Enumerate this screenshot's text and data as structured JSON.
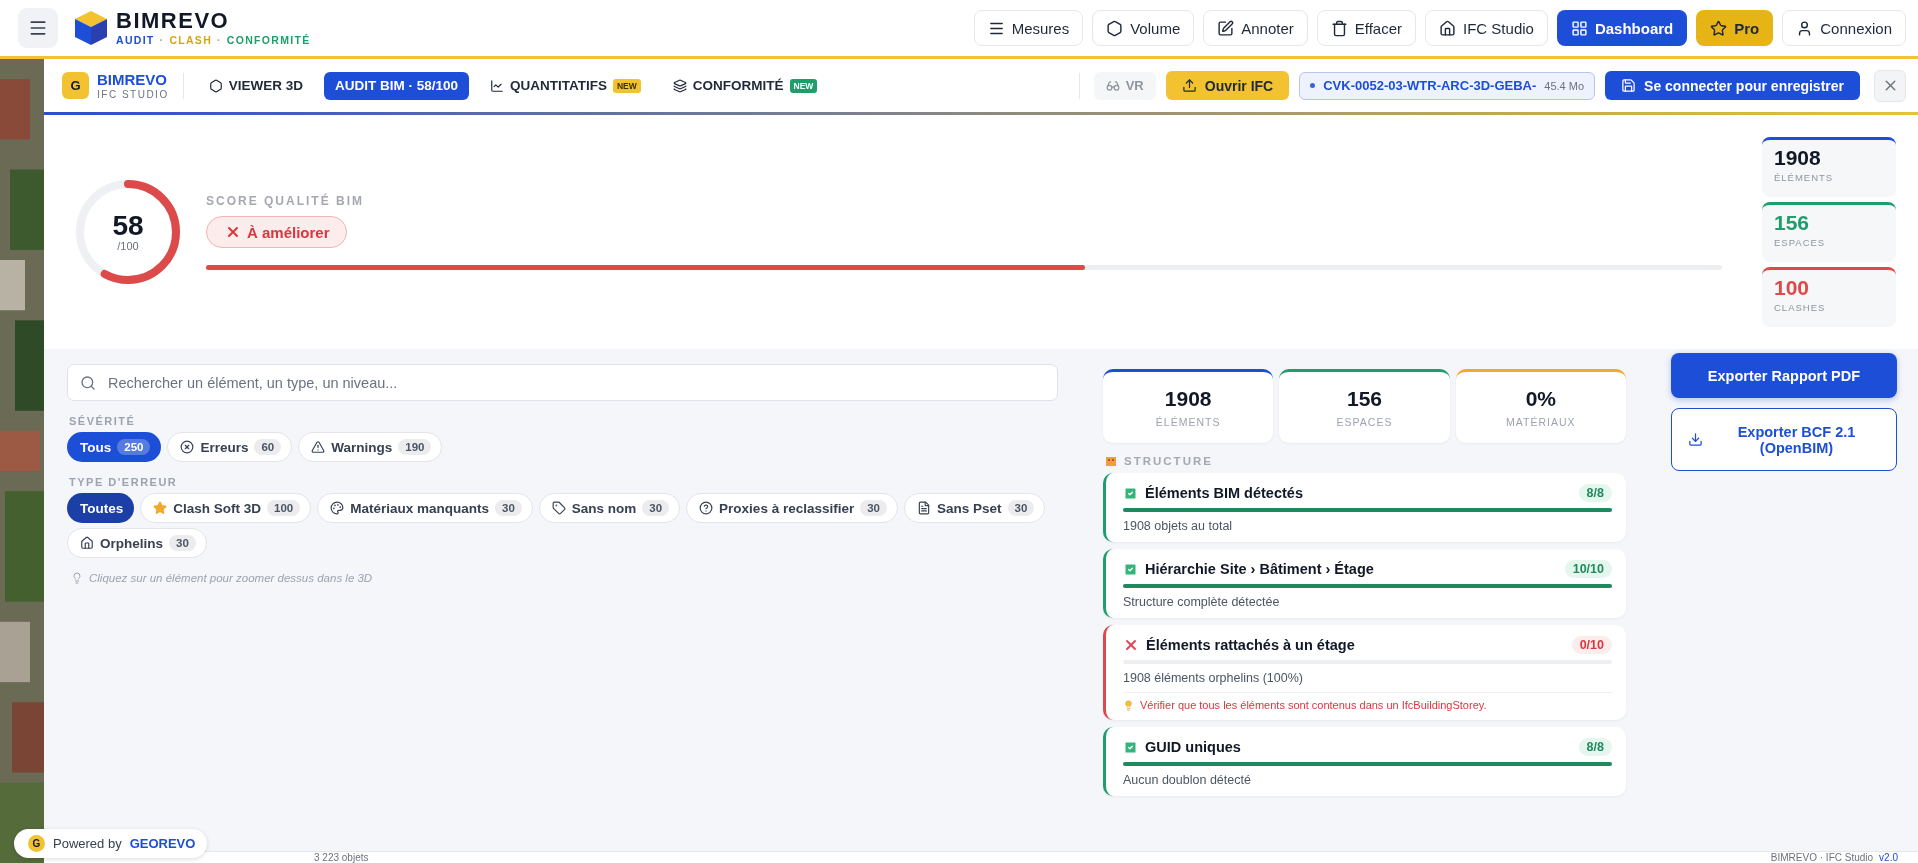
{
  "header": {
    "logo": {
      "name": "BIMREVO",
      "tagline": [
        {
          "text": "AUDIT",
          "color": "#1d4ed8"
        },
        {
          "text": "·"
        },
        {
          "text": "CLASH",
          "color": "#d4a514"
        },
        {
          "text": "·"
        },
        {
          "text": "CONFORMITÉ",
          "color": "#1f9d6b"
        }
      ]
    },
    "actions": [
      {
        "label": "Mesures",
        "kind": "plain"
      },
      {
        "label": "Volume",
        "kind": "plain"
      },
      {
        "label": "Annoter",
        "kind": "plain"
      },
      {
        "label": "Effacer",
        "kind": "plain"
      },
      {
        "label": "IFC Studio",
        "kind": "plain"
      },
      {
        "label": "Dashboard",
        "kind": "primary"
      },
      {
        "label": "Pro",
        "kind": "pro"
      },
      {
        "label": "Connexion",
        "kind": "plain"
      }
    ]
  },
  "toolbar": {
    "brand": {
      "badge": "G",
      "name": "BIMREVO",
      "subtitle": "IFC STUDIO"
    },
    "tabs": [
      {
        "label": "VIEWER 3D",
        "selected": false
      },
      {
        "label": "AUDIT BIM · 58/100",
        "selected": true
      },
      {
        "label": "QUANTITATIFS",
        "selected": false,
        "badge": "NEW",
        "color": "#f2c230"
      },
      {
        "label": "CONFORMITÉ",
        "selected": false,
        "badge": "NEW",
        "color": "#1f9d6b"
      }
    ],
    "vr": {
      "label": "VR",
      "disabled": true
    },
    "open_button": "Ouvrir IFC",
    "file": {
      "name": "CVK-0052-03-WTR-ARC-3D-GEBA-",
      "size": "45.4 Mo"
    },
    "save_button": "Se connecter pour enregistrer"
  },
  "score": {
    "value": "58",
    "max": "/100",
    "level": 0.58,
    "label": "SCORE QUALITÉ BIM",
    "status": "À améliorer"
  },
  "side_stats": [
    {
      "value": "1908",
      "label": "ÉLÉMENTS",
      "color": "#1d4ed8"
    },
    {
      "value": "156",
      "label": "ESPACES",
      "color": "#1f9d6b"
    },
    {
      "value": "100",
      "label": "CLASHES",
      "color": "#dc4a4a"
    }
  ],
  "search": {
    "placeholder": "Rechercher un élément, un type, un niveau..."
  },
  "severity": {
    "heading": "SÉVÉRITÉ",
    "chips": [
      {
        "label": "Tous",
        "count": "250",
        "selected": true
      },
      {
        "label": "Erreurs",
        "count": "60",
        "selected": false
      },
      {
        "label": "Warnings",
        "count": "190",
        "selected": false
      }
    ]
  },
  "error_types": {
    "heading": "TYPE D'ERREUR",
    "chips": [
      {
        "label": "Toutes",
        "selected": true
      },
      {
        "label": "Clash Soft 3D",
        "count": "100",
        "selected": false
      },
      {
        "label": "Matériaux manquants",
        "count": "30",
        "selected": false
      },
      {
        "label": "Sans nom",
        "count": "30",
        "selected": false
      },
      {
        "label": "Proxies à reclassifier",
        "count": "30",
        "selected": false
      },
      {
        "label": "Sans Pset",
        "count": "30",
        "selected": false
      },
      {
        "label": "Orphelins",
        "count": "30",
        "selected": false
      }
    ]
  },
  "hint": "Cliquez sur un élément pour zoomer dessus dans le 3D",
  "stats": [
    {
      "value": "1908",
      "label": "ÉLÉMENTS",
      "color": "#1d4ed8"
    },
    {
      "value": "156",
      "label": "ESPACES",
      "color": "#1f9d6b"
    },
    {
      "value": "0%",
      "label": "MATÉRIAUX",
      "color": "#f0a92a"
    }
  ],
  "section": {
    "title": "STRUCTURE"
  },
  "checks": [
    {
      "title": "Éléments BIM détectés",
      "score": "8/8",
      "passed": true,
      "detail": "1908 objets au total"
    },
    {
      "title": "Hiérarchie Site › Bâtiment › Étage",
      "score": "10/10",
      "passed": true,
      "detail": "Structure complète détectée"
    },
    {
      "title": "Éléments rattachés à un étage",
      "score": "0/10",
      "passed": false,
      "detail": "1908 éléments orphelins (100%)",
      "tip": "Vérifier que tous les éléments sont contenus dans un IfcBuildingStorey."
    },
    {
      "title": "GUID uniques",
      "score": "8/8",
      "passed": true,
      "detail": "Aucun doublon détecté"
    }
  ],
  "exports": [
    {
      "label": "Exporter Rapport PDF",
      "kind": "primary"
    },
    {
      "label": "Exporter BCF 2.1 (OpenBIM)",
      "kind": "outline"
    }
  ],
  "powered": {
    "badge": "G",
    "text": "Powered by",
    "brand": "GEOREVO"
  },
  "status_bar": {
    "left": "3 223 objets",
    "right": "BIMREVO · IFC Studio",
    "version": "v2.0"
  }
}
